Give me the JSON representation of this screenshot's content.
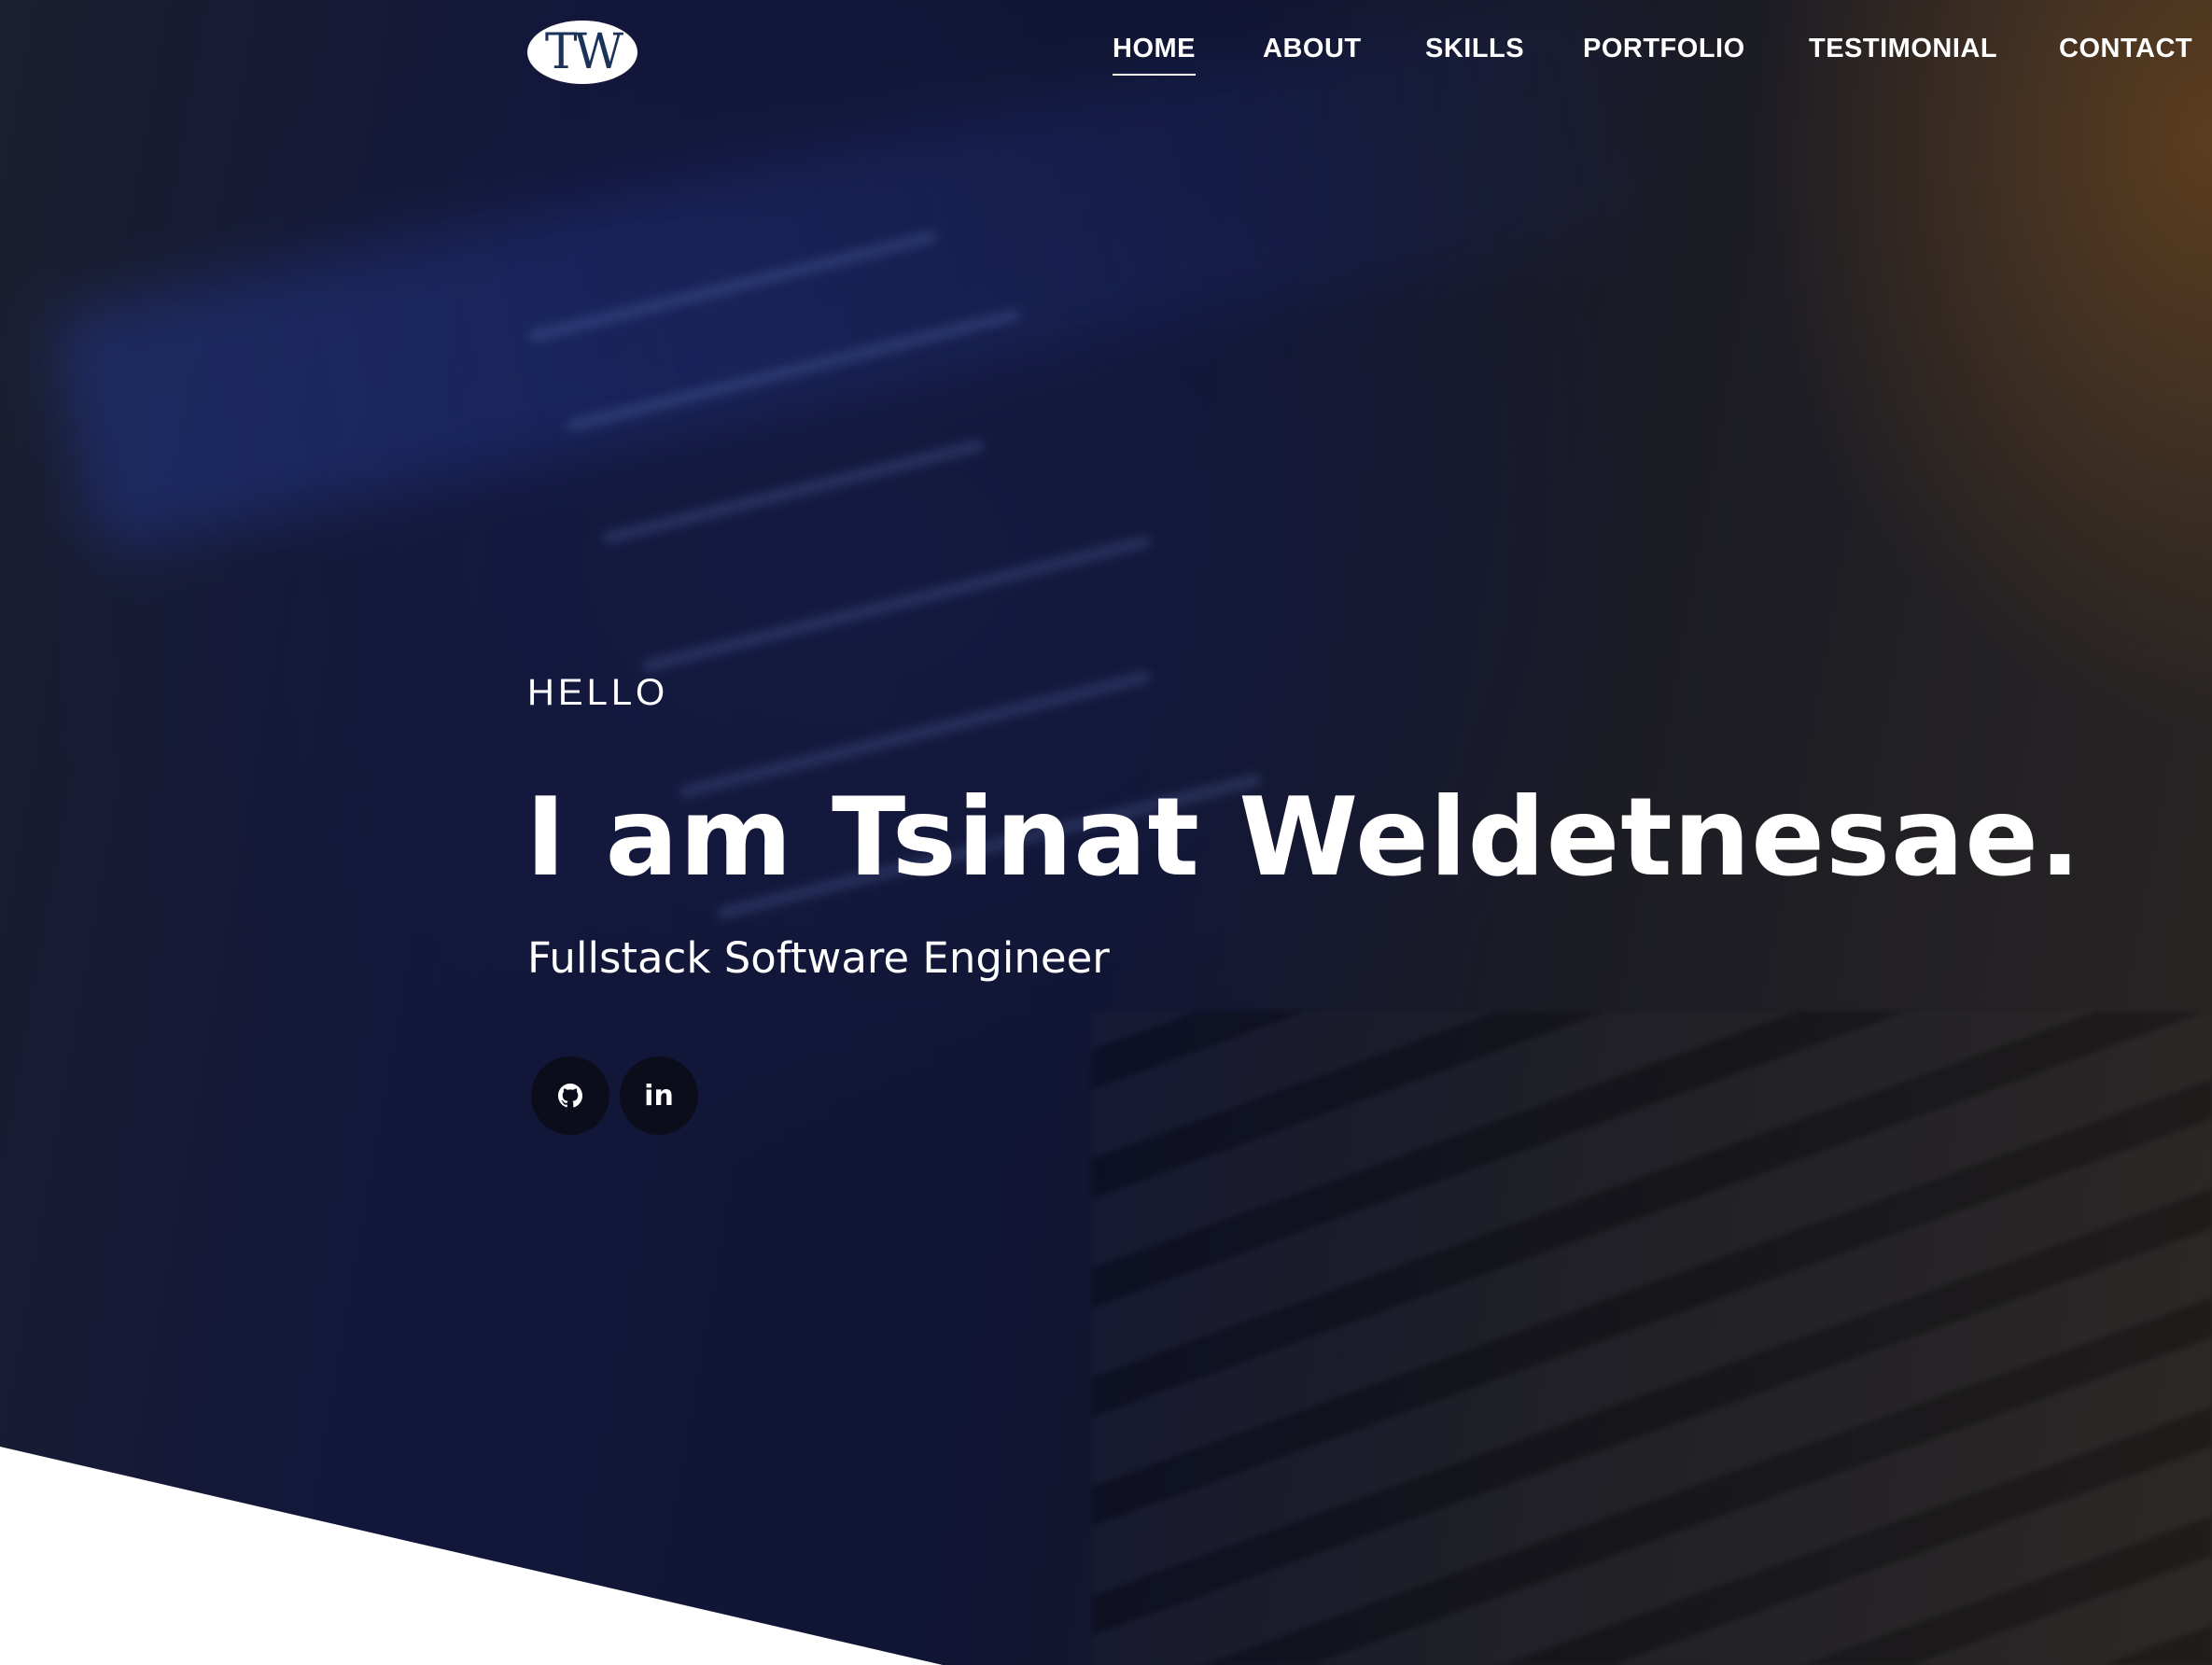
{
  "logo": {
    "text": "TW"
  },
  "nav": [
    {
      "label": "HOME",
      "active": true
    },
    {
      "label": "ABOUT"
    },
    {
      "label": "SKILLS"
    },
    {
      "label": "PORTFOLIO"
    },
    {
      "label": "TESTIMONIAL"
    },
    {
      "label": "CONTACT"
    }
  ],
  "hero": {
    "greeting": "HELLO",
    "title": "I am Tsinat Weldetnesae.",
    "subtitle": "Fullstack Software Engineer"
  },
  "social": [
    {
      "icon": "github-icon"
    },
    {
      "icon": "linkedin-icon",
      "text": "in"
    }
  ]
}
